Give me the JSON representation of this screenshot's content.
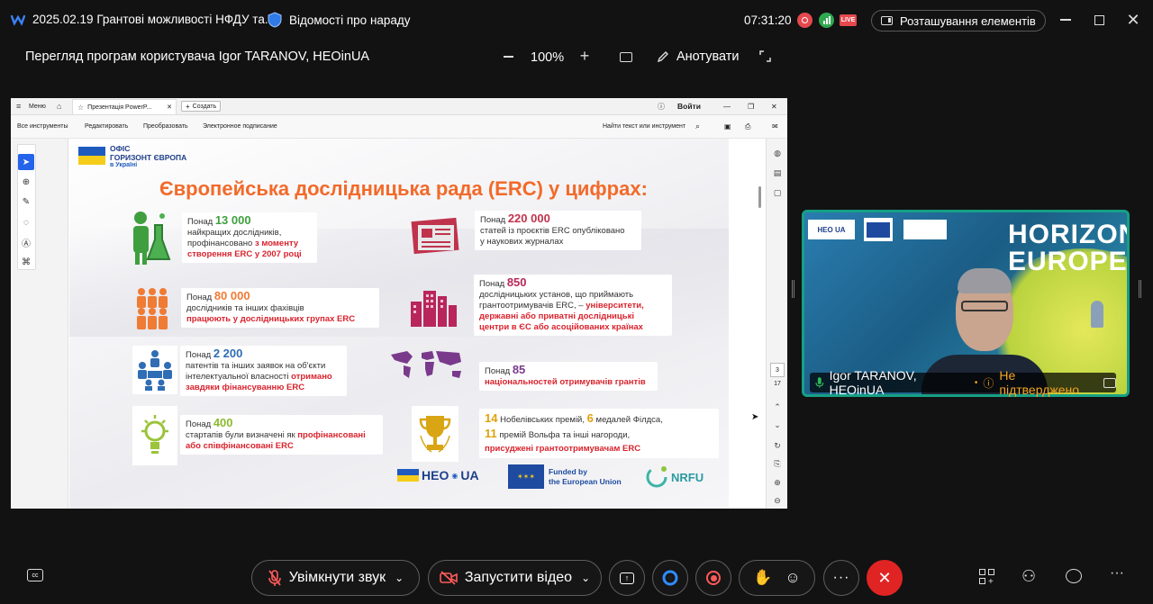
{
  "titlebar": {
    "meeting_title": "2025.02.19 Грантові можливості НФДУ та...",
    "tab_title": "Відомості про нараду",
    "time": "07:31:20",
    "live_badge": "LIVE",
    "layout_button": "Розташування елементів"
  },
  "sharebar": {
    "viewing_label": "Перегляд програм користувача Igor  TARANOV, HEOinUA",
    "zoom": "100%",
    "annotate_label": "Анотувати"
  },
  "shared": {
    "tabs": {
      "menu": "Меню",
      "doc_tab": "Презентація PowerP...",
      "create": "Создать",
      "login": "Войти"
    },
    "tools": {
      "all": "Все инструменты",
      "edit": "Редактировать",
      "convert": "Преобразовать",
      "esign": "Электронное подписание",
      "search": "Найти текст или инструмент"
    },
    "pages": {
      "current": "3",
      "total": "17"
    },
    "slide": {
      "org": {
        "line1": "ОФІС",
        "line2": "ГОРИЗОНТ ЄВРОПА",
        "line3": "в Україні"
      },
      "title": "Європейська дослідницька рада (ERC) у цифрах:",
      "facts": [
        {
          "prefix": "Понад",
          "number": "13 000",
          "text1": "найкращих дослідників,",
          "text2": "профінансовано",
          "red1": "з моменту",
          "red2": "створення ERC у 2007 році"
        },
        {
          "prefix": "Понад",
          "number": "80 000",
          "text1": "дослідників та інших фахівців",
          "red1": "працюють у дослідницьких групах ERC"
        },
        {
          "prefix": "Понад",
          "number": "2 200",
          "text1": "патентів та інших заявок на об'єкти",
          "text2": "інтелектуальної власності",
          "red1": "отримано",
          "red2": "завдяки фінансуванню ERC"
        },
        {
          "prefix": "Понад",
          "number": "400",
          "text1": "стартапів були визначені як",
          "red1": "профінансовані",
          "red2": "або співфінансовані ERC"
        },
        {
          "prefix": "Понад",
          "number": "220 000",
          "text1": "статей із проєктів ERC опубліковано",
          "text2": "у наукових журналах"
        },
        {
          "prefix": "Понад",
          "number": "850",
          "text1": "дослідницьких установ, що приймають",
          "text2": "грантоотримувачів ERC, –",
          "red1": "університети,",
          "red2": "державні або приватні дослідницькі",
          "red3": "центри в ЄС або асоційованих країнах"
        },
        {
          "prefix": "Понад",
          "number": "85",
          "red1": "національностей отримувачів грантів"
        },
        {
          "num1": "14",
          "text1": "Нобелівських премій,",
          "num2": "6",
          "text2": "медалей Філдса,",
          "num3": "11",
          "text3": "премій Вольфа та інші нагороди,",
          "red1": "присуджені грантоотримувачам ERC"
        }
      ],
      "footer": {
        "heo": "HEO",
        "heo_ua": "UA",
        "eu_line1": "Funded by",
        "eu_line2": "the European Union",
        "nrfu": "NRFU"
      }
    }
  },
  "video": {
    "participant_name": "Igor  TARANOV, HEOinUA",
    "status": "Не підтверджено",
    "banner_text": "HORIZON EUROPE",
    "logo_text": "HEO UA"
  },
  "bottom": {
    "unmute_label": "Увімкнути звук",
    "video_label": "Запустити відео"
  },
  "colors": {
    "accent_orange": "#f26a2a",
    "red": "#d9232d",
    "green_border": "#16a085",
    "end_call": "#e02424"
  }
}
